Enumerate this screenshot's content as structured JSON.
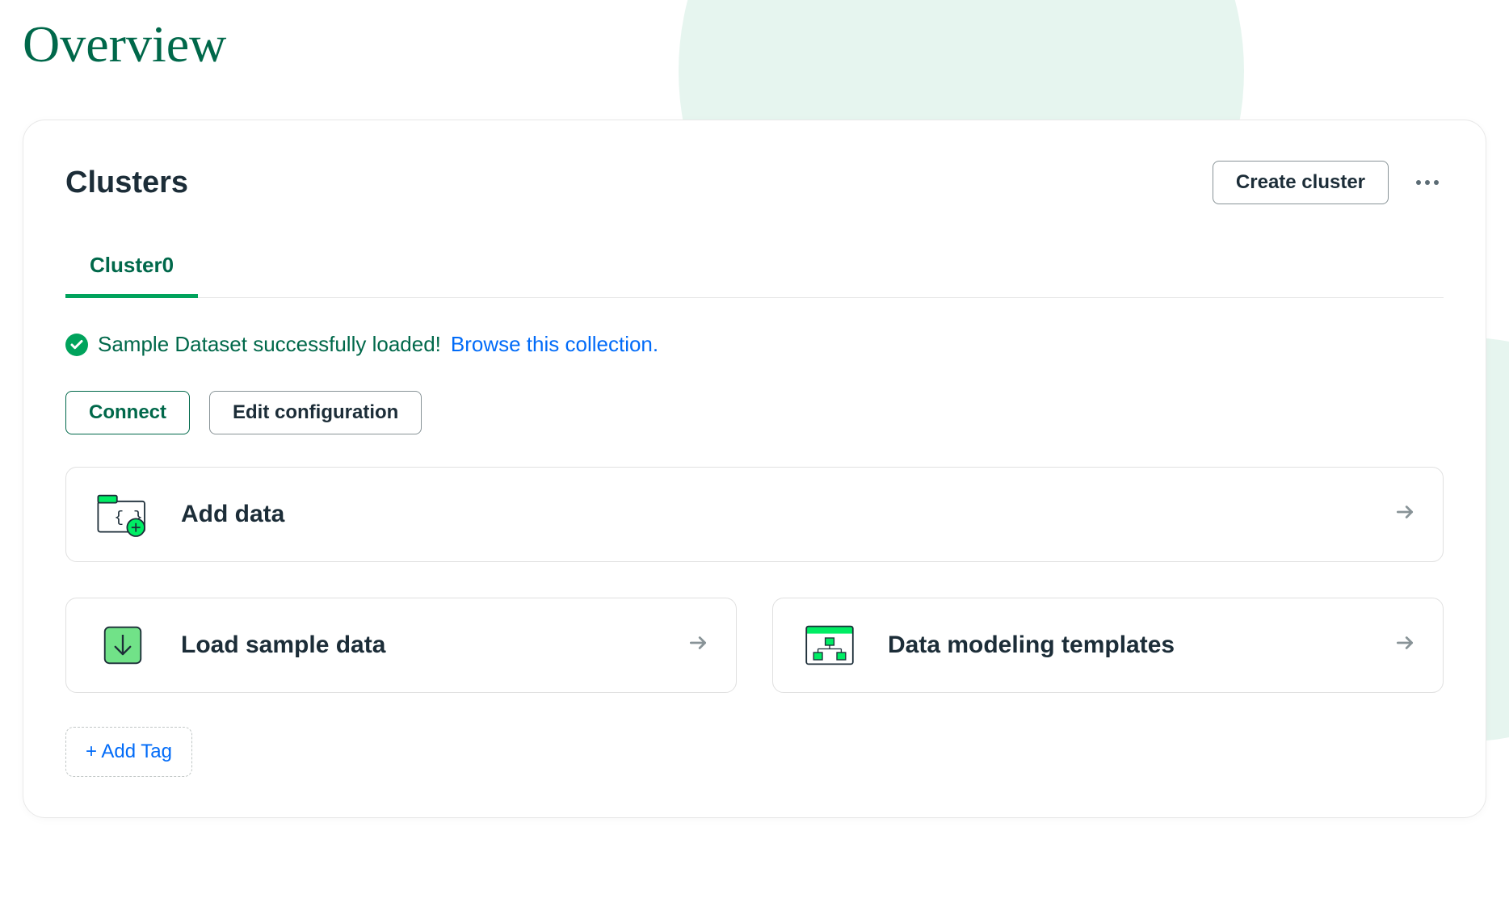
{
  "page": {
    "title": "Overview"
  },
  "card": {
    "heading": "Clusters",
    "create_button": "Create cluster"
  },
  "tabs": [
    {
      "label": "Cluster0"
    }
  ],
  "status": {
    "message": "Sample Dataset successfully loaded!",
    "link": "Browse this collection."
  },
  "buttons": {
    "connect": "Connect",
    "edit_config": "Edit configuration"
  },
  "actions": {
    "add_data": "Add data",
    "load_sample": "Load sample data",
    "templates": "Data modeling templates"
  },
  "tags": {
    "add": "+ Add Tag"
  }
}
